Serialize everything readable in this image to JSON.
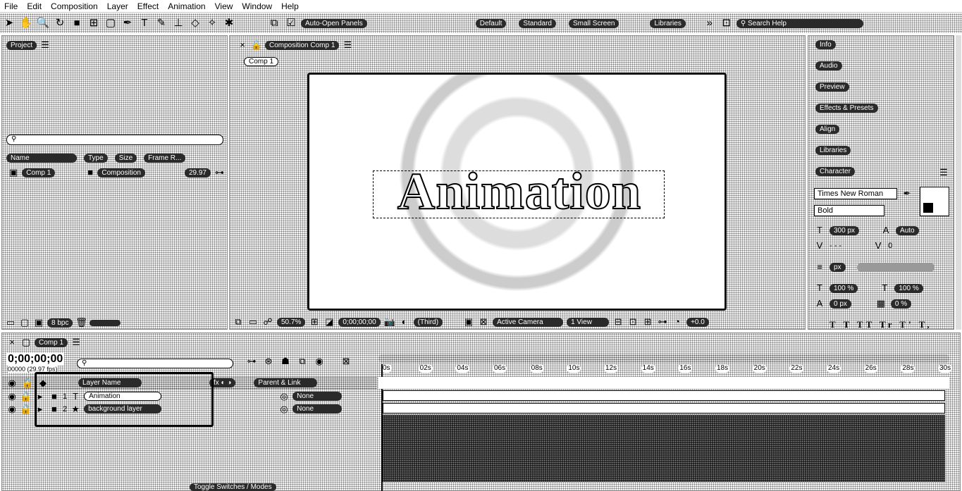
{
  "menu": [
    "File",
    "Edit",
    "Composition",
    "Layer",
    "Effect",
    "Animation",
    "View",
    "Window",
    "Help"
  ],
  "toolbar": {
    "auto_open_label": "Auto-Open Panels",
    "workspaces": [
      "Default",
      "Standard",
      "Small Screen",
      "Libraries"
    ],
    "search_placeholder": "Search Help"
  },
  "project": {
    "title": "Project",
    "columns": [
      "Name",
      "Type",
      "Size",
      "Frame R..."
    ],
    "items": [
      {
        "name": "Comp 1",
        "type": "Composition",
        "fps": "29.97"
      }
    ],
    "bpc": "8 bpc"
  },
  "viewer": {
    "title": "Composition Comp 1",
    "tab": "Comp 1",
    "text": "Animation",
    "zoom": "50.7%",
    "timecode": "0;00;00;00",
    "resolution": "(Third)",
    "camera": "Active Camera",
    "view": "1 View",
    "exposure": "+0.0"
  },
  "right_panels": [
    "Info",
    "Audio",
    "Preview",
    "Effects & Presets",
    "Align",
    "Libraries",
    "Character"
  ],
  "character": {
    "font": "Times New Roman",
    "style": "Bold",
    "size": "300 px",
    "leading": "Auto",
    "kerning": "- - -",
    "tracking": "0",
    "stroke": "px",
    "vscale": "100 %",
    "hscale": "100 %",
    "baseline": "0 px",
    "tsume": "0 %"
  },
  "timeline": {
    "tab": "Comp 1",
    "timecode": "0;00;00;00",
    "fps_line": "00000 (29.97 fps)",
    "header": {
      "layer_name": "Layer Name",
      "parent": "Parent & Link"
    },
    "layers": [
      {
        "num": "1",
        "name": "Animation",
        "parent": "None"
      },
      {
        "num": "2",
        "name": "background layer",
        "parent": "None"
      }
    ],
    "ruler": [
      "0s",
      "02s",
      "04s",
      "06s",
      "08s",
      "10s",
      "12s",
      "14s",
      "16s",
      "18s",
      "20s",
      "22s",
      "24s",
      "26s",
      "28s",
      "30s"
    ],
    "toggle_label": "Toggle Switches / Modes"
  }
}
